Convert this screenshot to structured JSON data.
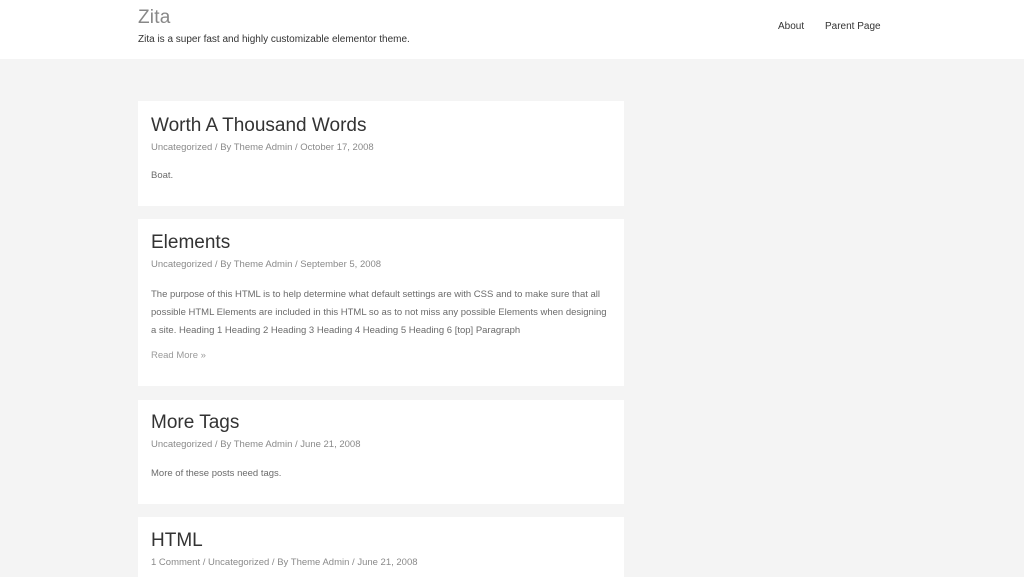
{
  "header": {
    "site_title": "Zita",
    "tagline": "Zita is a super fast and highly customizable elementor theme.",
    "nav": [
      {
        "label": "About"
      },
      {
        "label": "Parent Page"
      }
    ]
  },
  "posts": [
    {
      "title": "Worth A Thousand Words",
      "category": "Uncategorized",
      "author": "By Theme Admin",
      "date": "October 17, 2008",
      "excerpt": "Boat."
    },
    {
      "title": "Elements",
      "category": "Uncategorized",
      "author": "By Theme Admin",
      "date": "September 5, 2008",
      "excerpt": "The purpose of this HTML is to help determine what default settings are with CSS and to make sure that all possible HTML Elements are included in this HTML so as to not miss any possible Elements when designing a site. Heading 1 Heading 2 Heading 3 Heading 4 Heading 5 Heading 6 [top] Paragraph",
      "read_more": "Read More »"
    },
    {
      "title": "More Tags",
      "category": "Uncategorized",
      "author": "By Theme Admin",
      "date": "June 21, 2008",
      "excerpt": "More of these posts need tags."
    },
    {
      "title": "HTML",
      "comments": "1 Comment",
      "category": "Uncategorized",
      "author": "By Theme Admin",
      "date": "June 21, 2008"
    }
  ],
  "separator": " / "
}
